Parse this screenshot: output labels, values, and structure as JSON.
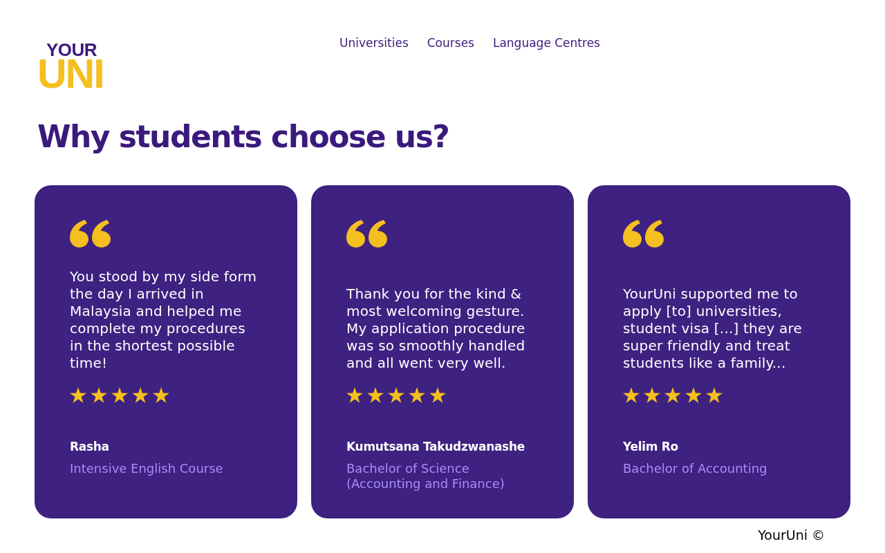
{
  "logo": {
    "line_1": "YOUR",
    "line_2": "UNI"
  },
  "nav": [
    {
      "label": "Universities"
    },
    {
      "label": "Courses"
    },
    {
      "label": "Language Centres"
    }
  ],
  "heading": "Why students choose us?",
  "testimonials": [
    {
      "quote": "You stood by my side form the day I arrived in Malaysia and helped me complete my procedures in the shortest possible time!",
      "stars": 5,
      "name": "Rasha",
      "course": "Intensive English Course"
    },
    {
      "quote": "Thank you for the kind & most welcoming gesture. My application procedure was so smoothly handled and all went very well.",
      "stars": 5,
      "name": "Kumutsana Takudzwanashe",
      "course": "Bachelor of Science (Accounting and Finance)"
    },
    {
      "quote": "YourUni supported me to apply [to] universities, student visa [...] they are super friendly and treat students like a family...",
      "stars": 5,
      "name": "Yelim Ro",
      "course": "Bachelor of Accounting"
    }
  ],
  "footer": "YourUni ©"
}
